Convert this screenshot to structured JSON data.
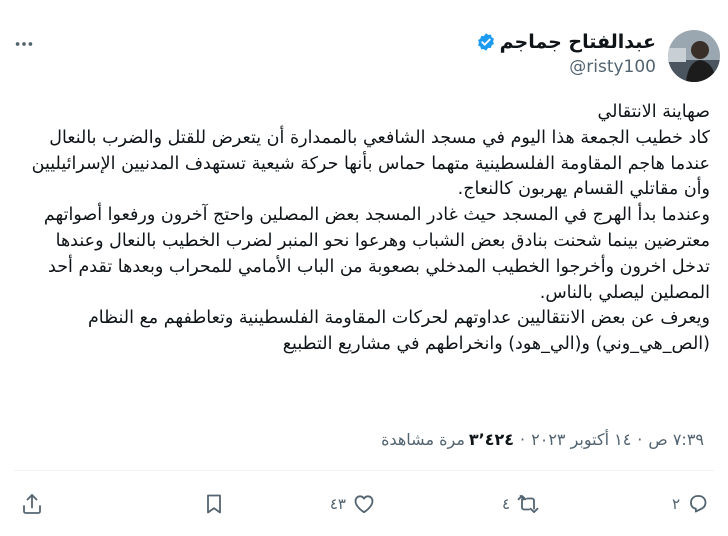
{
  "author": {
    "display_name": "عبدالفتاح جماجم",
    "handle": "@risty100",
    "verified": true,
    "verified_color": "#1d9bf0"
  },
  "tweet": {
    "paragraphs": [
      "صهاينة الانتقالي",
      "كاد خطيب الجمعة هذا اليوم في  مسجد الشافعي بالممدارة أن يتعرض للقتل والضرب بالنعال عندما هاجم المقاومة الفلسطينية متهما حماس بأنها حركة شيعية تستهدف المدنيين الإسرائيليين وأن مقاتلي القسام يهربون كالنعاج.",
      "وعندما بدأ الهرج في المسجد حيث غادر المسجد بعض المصلين واحتج آخرون ورفعوا أصواتهم معترضين بينما شحنت بنادق بعض الشباب وهرعوا نحو المنبر لضرب الخطيب بالنعال وعندها تدخل اخرون وأخرجوا الخطيب المدخلي بصعوبة من الباب الأمامي للمحراب وبعدها تقدم أحد المصلين ليصلي بالناس.",
      "ويعرف عن بعض الانتقاليين عداوتهم لحركات المقاومة الفلسطينية وتعاطفهم مع النظام (الص_هي_وني) و(الي_هود) وانخراطهم في مشاريع التطبيع"
    ]
  },
  "meta": {
    "time": "٧:٣٩ ص",
    "date": "١٤ أكتوبر ٢٠٢٣",
    "views_count": "٣٬٤٢٤",
    "views_label": "مرة مشاهدة",
    "separator": "·"
  },
  "actions": {
    "replies": "٢",
    "reposts": "٤",
    "likes": "٤٣"
  },
  "icons": {
    "more": "more-icon",
    "verified": "verified-badge-icon",
    "reply": "reply-icon",
    "repost": "repost-icon",
    "like": "heart-icon",
    "bookmark": "bookmark-icon",
    "share": "share-icon"
  }
}
